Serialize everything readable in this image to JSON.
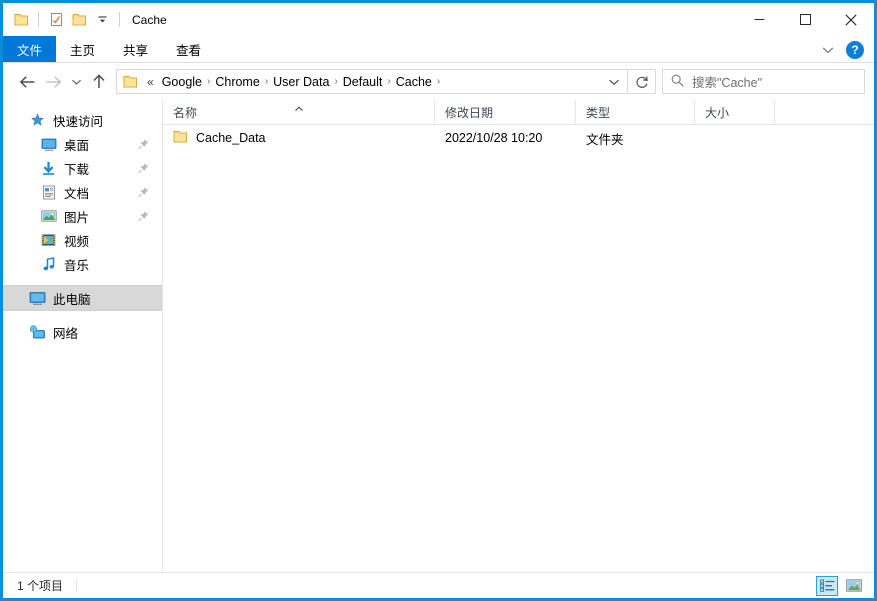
{
  "window": {
    "title": "Cache",
    "accent_color": "#0a8ed9",
    "ribbon_accent": "#0078d7"
  },
  "quick_access_toolbar": {
    "items": [
      {
        "name": "folder-icon",
        "label": "Cache"
      },
      {
        "name": "properties-icon",
        "label": "属性"
      },
      {
        "name": "new-folder-icon",
        "label": "新建文件夹"
      },
      {
        "name": "customize-dropdown-icon",
        "label": "自定义快速访问工具栏"
      }
    ]
  },
  "window_controls": {
    "minimize": "最小化",
    "maximize": "最大化",
    "close": "关闭"
  },
  "ribbon": {
    "tabs": [
      {
        "label": "文件",
        "active": true
      },
      {
        "label": "主页",
        "active": false
      },
      {
        "label": "共享",
        "active": false
      },
      {
        "label": "查看",
        "active": false
      }
    ],
    "expand_label": "展开功能区",
    "help_label": "?"
  },
  "navigation": {
    "back_label": "返回",
    "forward_label": "前进",
    "recent_label": "最近浏览的位置",
    "up_label": "上一级",
    "refresh_label": "刷新",
    "breadcrumb": {
      "ellipsis": "«",
      "separator": "›",
      "items": [
        "Google",
        "Chrome",
        "User Data",
        "Default",
        "Cache"
      ]
    },
    "dropdown_label": "以前的位置"
  },
  "search": {
    "placeholder": "搜索\"Cache\""
  },
  "sidebar": {
    "items": [
      {
        "label": "快速访问",
        "icon": "pin-star-icon",
        "level": 1,
        "pinned": false,
        "selected": false
      },
      {
        "label": "桌面",
        "icon": "desktop-icon",
        "level": 2,
        "pinned": true,
        "selected": false
      },
      {
        "label": "下载",
        "icon": "download-icon",
        "level": 2,
        "pinned": true,
        "selected": false
      },
      {
        "label": "文档",
        "icon": "documents-icon",
        "level": 2,
        "pinned": true,
        "selected": false
      },
      {
        "label": "图片",
        "icon": "pictures-icon",
        "level": 2,
        "pinned": true,
        "selected": false
      },
      {
        "label": "视频",
        "icon": "videos-icon",
        "level": 2,
        "pinned": false,
        "selected": false
      },
      {
        "label": "音乐",
        "icon": "music-icon",
        "level": 2,
        "pinned": false,
        "selected": false
      },
      {
        "label": "此电脑",
        "icon": "this-pc-icon",
        "level": 1,
        "pinned": false,
        "selected": true
      },
      {
        "label": "网络",
        "icon": "network-icon",
        "level": 1,
        "pinned": false,
        "selected": false
      }
    ]
  },
  "file_list": {
    "columns": [
      {
        "label": "名称",
        "sorted": "asc"
      },
      {
        "label": "修改日期",
        "sorted": ""
      },
      {
        "label": "类型",
        "sorted": ""
      },
      {
        "label": "大小",
        "sorted": ""
      }
    ],
    "rows": [
      {
        "name": "Cache_Data",
        "date": "2022/10/28 10:20",
        "type": "文件夹",
        "size": "",
        "icon": "folder-icon"
      }
    ]
  },
  "statusbar": {
    "item_count": "1 个项目",
    "views": [
      {
        "name": "details-view-button",
        "label": "详细信息",
        "active": true
      },
      {
        "name": "large-icons-view-button",
        "label": "大图标",
        "active": false
      }
    ]
  }
}
